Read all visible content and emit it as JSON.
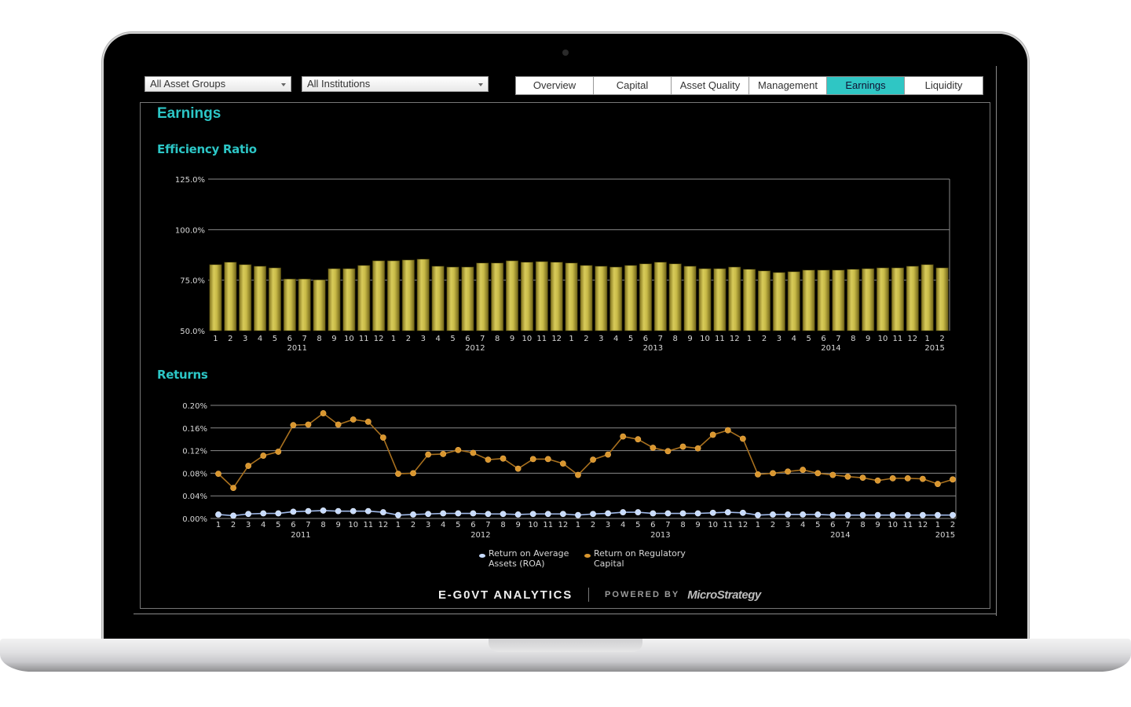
{
  "filters": {
    "asset_group": "All Asset Groups",
    "institution": "All Institutions"
  },
  "tabs": [
    {
      "label": "Overview",
      "active": false
    },
    {
      "label": "Capital",
      "active": false
    },
    {
      "label": "Asset Quality",
      "active": false
    },
    {
      "label": "Management",
      "active": false
    },
    {
      "label": "Earnings",
      "active": true
    },
    {
      "label": "Liquidity",
      "active": false
    }
  ],
  "page": {
    "title": "Earnings",
    "accent_color": "#2cc6c6"
  },
  "footer": {
    "brand": "E-G0VT ANALYTICS",
    "powered_by": "POWERED BY",
    "vendor": "MicroStrategy"
  },
  "chart_data": [
    {
      "type": "bar",
      "title": "Efficiency Ratio",
      "xlabel": "",
      "ylabel": "",
      "ylim": [
        50,
        125
      ],
      "yticks": [
        "50.0%",
        "75.0%",
        "100.0%",
        "125.0%"
      ],
      "ytick_values": [
        50,
        75,
        100,
        125
      ],
      "grid": true,
      "bar_color": "#c8b84a",
      "categories": [
        "1",
        "2",
        "3",
        "4",
        "5",
        "6",
        "7",
        "8",
        "9",
        "10",
        "11",
        "12",
        "1",
        "2",
        "3",
        "4",
        "5",
        "6",
        "7",
        "8",
        "9",
        "10",
        "11",
        "12",
        "1",
        "2",
        "3",
        "4",
        "5",
        "6",
        "7",
        "8",
        "9",
        "10",
        "11",
        "12",
        "1",
        "2",
        "3",
        "4",
        "5",
        "6",
        "7",
        "8",
        "9",
        "10",
        "11",
        "12",
        "1",
        "2"
      ],
      "year_labels": [
        {
          "label": "2011",
          "center_index": 5.5
        },
        {
          "label": "2012",
          "center_index": 17.5
        },
        {
          "label": "2013",
          "center_index": 29.5
        },
        {
          "label": "2014",
          "center_index": 41.5
        },
        {
          "label": "2015",
          "center_index": 48.5
        }
      ],
      "values": [
        82.7,
        83.9,
        82.7,
        81.9,
        81.1,
        75.6,
        75.6,
        75.2,
        80.7,
        80.7,
        82.3,
        84.6,
        84.6,
        85.0,
        85.4,
        81.9,
        81.5,
        81.5,
        83.5,
        83.5,
        84.6,
        83.9,
        84.2,
        83.9,
        83.5,
        82.3,
        81.9,
        81.5,
        82.3,
        83.1,
        83.9,
        83.1,
        81.9,
        80.7,
        80.7,
        81.5,
        80.4,
        79.6,
        78.8,
        79.2,
        80.0,
        80.0,
        80.0,
        80.4,
        80.7,
        81.1,
        81.1,
        81.9,
        82.7,
        81.1
      ]
    },
    {
      "type": "line",
      "title": "Returns",
      "xlabel": "",
      "ylabel": "",
      "ylim": [
        0,
        0.2
      ],
      "yticks": [
        "0.00%",
        "0.04%",
        "0.08%",
        "0.12%",
        "0.16%",
        "0.20%"
      ],
      "ytick_values": [
        0,
        0.04,
        0.08,
        0.12,
        0.16,
        0.2
      ],
      "grid": true,
      "legend_position": "bottom",
      "categories": [
        "1",
        "2",
        "3",
        "4",
        "5",
        "6",
        "7",
        "8",
        "9",
        "10",
        "11",
        "12",
        "1",
        "2",
        "3",
        "4",
        "5",
        "6",
        "7",
        "8",
        "9",
        "10",
        "11",
        "12",
        "1",
        "2",
        "3",
        "4",
        "5",
        "6",
        "7",
        "8",
        "9",
        "10",
        "11",
        "12",
        "1",
        "2",
        "3",
        "4",
        "5",
        "6",
        "7",
        "8",
        "9",
        "10",
        "11",
        "12",
        "1",
        "2"
      ],
      "year_labels": [
        {
          "label": "2011",
          "center_index": 5.5
        },
        {
          "label": "2012",
          "center_index": 17.5
        },
        {
          "label": "2013",
          "center_index": 29.5
        },
        {
          "label": "2014",
          "center_index": 41.5
        },
        {
          "label": "2015",
          "center_index": 48.5
        }
      ],
      "series": [
        {
          "name": "Return on Average Assets (ROA)",
          "legend_lines": [
            "Return on Average",
            "Assets (ROA)"
          ],
          "color": "#c8dcff",
          "values": [
            0.007,
            0.005,
            0.008,
            0.009,
            0.009,
            0.012,
            0.013,
            0.014,
            0.013,
            0.013,
            0.013,
            0.011,
            0.006,
            0.007,
            0.008,
            0.009,
            0.009,
            0.009,
            0.008,
            0.008,
            0.007,
            0.008,
            0.008,
            0.008,
            0.006,
            0.008,
            0.009,
            0.011,
            0.011,
            0.009,
            0.009,
            0.009,
            0.009,
            0.01,
            0.011,
            0.01,
            0.006,
            0.007,
            0.007,
            0.007,
            0.007,
            0.006,
            0.006,
            0.006,
            0.006,
            0.006,
            0.006,
            0.006,
            0.006,
            0.006
          ]
        },
        {
          "name": "Return on Regulatory Capital",
          "legend_lines": [
            "Return on Regulatory",
            "Capital"
          ],
          "color": "#d9962e",
          "values": [
            0.079,
            0.054,
            0.093,
            0.111,
            0.118,
            0.165,
            0.166,
            0.186,
            0.166,
            0.175,
            0.171,
            0.143,
            0.079,
            0.08,
            0.113,
            0.114,
            0.121,
            0.116,
            0.104,
            0.106,
            0.088,
            0.105,
            0.105,
            0.097,
            0.077,
            0.104,
            0.113,
            0.145,
            0.14,
            0.125,
            0.119,
            0.127,
            0.124,
            0.148,
            0.156,
            0.141,
            0.078,
            0.08,
            0.083,
            0.086,
            0.08,
            0.077,
            0.074,
            0.072,
            0.067,
            0.071,
            0.071,
            0.07,
            0.061,
            0.069
          ]
        }
      ]
    }
  ]
}
